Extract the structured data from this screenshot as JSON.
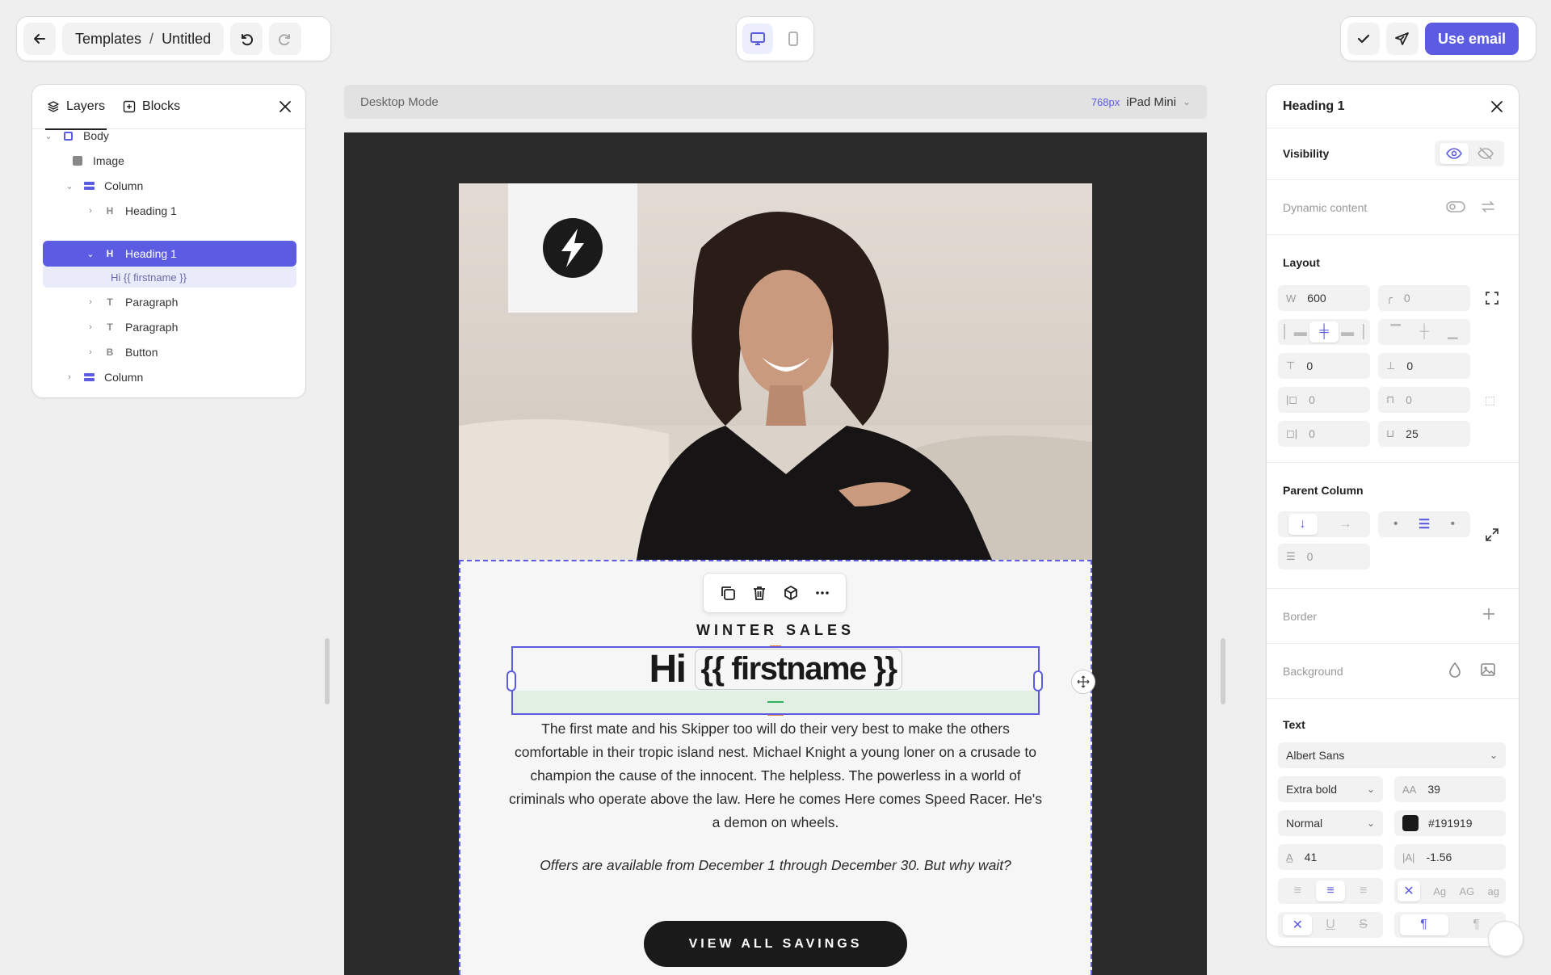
{
  "topbar": {
    "breadcrumb_root": "Templates",
    "breadcrumb_sep": "/",
    "breadcrumb_current": "Untitled",
    "use_email_label": "Use email"
  },
  "layers": {
    "tab_layers": "Layers",
    "tab_blocks": "Blocks",
    "tree": {
      "body": "Body",
      "image": "Image",
      "column1": "Column",
      "heading1a": "Heading 1",
      "heading1b": "Heading 1",
      "heading1b_child": "Hi {{ firstname }}",
      "paragraph1": "Paragraph",
      "paragraph2": "Paragraph",
      "button": "Button",
      "column2": "Column"
    },
    "type_letters": {
      "heading": "H",
      "paragraph": "T",
      "button": "B"
    }
  },
  "canvas": {
    "mode_label": "Desktop Mode",
    "viewport_px": "768px",
    "device": "iPad Mini"
  },
  "email": {
    "eyebrow": "WINTER SALES",
    "heading_hi": "Hi",
    "heading_var": "{{ firstname }}",
    "paragraph": "The first mate and his Skipper too will do their very best to make the others comfortable in their tropic island nest. Michael Knight a young loner on a crusade to champion the cause of the innocent. The helpless. The powerless in a world of criminals who operate above the law. Here he comes Here comes Speed Racer. He's a demon on wheels.",
    "offer": "Offers are available from December 1 through December 30. But why wait?",
    "cta": "VIEW ALL SAVINGS"
  },
  "props": {
    "title": "Heading 1",
    "visibility": "Visibility",
    "dynamic_content": "Dynamic content",
    "layout": "Layout",
    "width_label": "W",
    "width": "600",
    "radius": "0",
    "padding_top": "0",
    "padding_bottom": "0",
    "margin_left": "0",
    "margin_top": "0",
    "margin_right": "0",
    "margin_bottom": "25",
    "parent_column": "Parent Column",
    "gap": "0",
    "border": "Border",
    "background": "Background",
    "text": "Text",
    "font_family": "Albert Sans",
    "font_weight": "Extra bold",
    "font_size_label": "AA",
    "font_size": "39",
    "font_style": "Normal",
    "color_hex": "#191919",
    "line_height": "41",
    "letter_spacing_label": "|A|",
    "letter_spacing": "-1.56",
    "case_options": [
      "Ag",
      "AG",
      "ag"
    ]
  },
  "colors": {
    "accent": "#5b5ce2",
    "text_color_swatch": "#191919",
    "canvas_bg": "#2a2a2a",
    "cta_bg": "#1a1a1a"
  }
}
